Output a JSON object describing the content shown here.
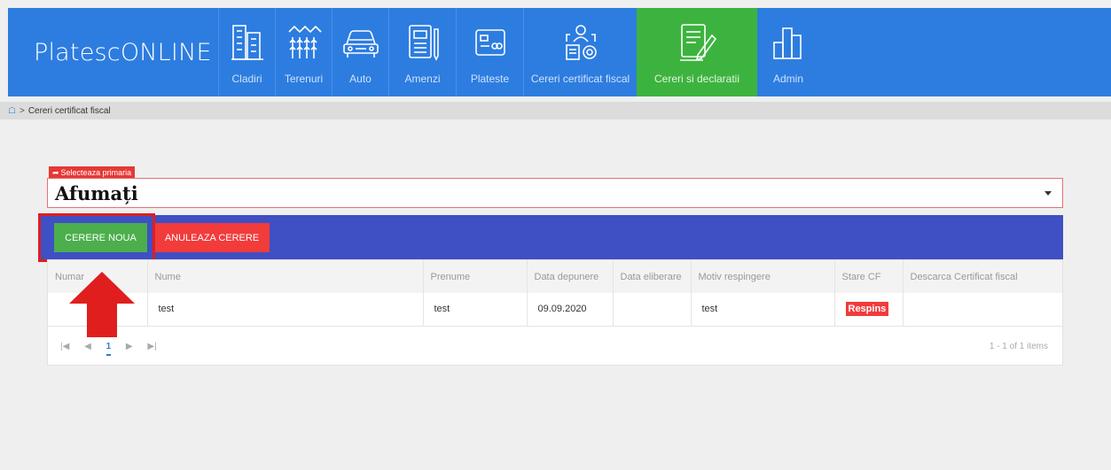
{
  "brand": "PlatescONLINE",
  "nav": [
    {
      "label": "Cladiri",
      "icon": "buildings-icon",
      "active": false
    },
    {
      "label": "Terenuri",
      "icon": "land-icon",
      "active": false
    },
    {
      "label": "Auto",
      "icon": "car-icon",
      "active": false
    },
    {
      "label": "Amenzi",
      "icon": "fine-document-icon",
      "active": false
    },
    {
      "label": "Plateste",
      "icon": "credit-card-icon",
      "active": false
    },
    {
      "label": "Cereri certificat fiscal",
      "icon": "certificate-request-icon",
      "active": false
    },
    {
      "label": "Cereri si declaratii",
      "icon": "declaration-edit-icon",
      "active": true
    },
    {
      "label": "Admin",
      "icon": "admin-chart-icon",
      "active": false
    }
  ],
  "breadcrumb": {
    "home_icon": "home-icon",
    "current": "Cereri certificat fiscal"
  },
  "select": {
    "tag": "Selecteaza primaria",
    "value": "Afumați"
  },
  "actions": {
    "new": "CERERE NOUA",
    "cancel": "ANULEAZA CERERE"
  },
  "grid": {
    "columns": [
      "Numar",
      "Nume",
      "Prenume",
      "Data depunere",
      "Data eliberare",
      "Motiv respingere",
      "Stare CF",
      "Descarca Certificat fiscal"
    ],
    "rows": [
      {
        "numar": "",
        "nume": "test",
        "prenume": "test",
        "data_depunere": "09.09.2020",
        "data_eliberare": "",
        "motiv": "test",
        "stare": "Respins",
        "descarca": ""
      }
    ],
    "pager": {
      "current_page": "1",
      "summary": "1 - 1 of 1 items"
    }
  },
  "colors": {
    "nav_blue": "#2d7de0",
    "active_green": "#3db33f",
    "action_bar": "#3f4fc4",
    "danger_red": "#f23b3b"
  }
}
